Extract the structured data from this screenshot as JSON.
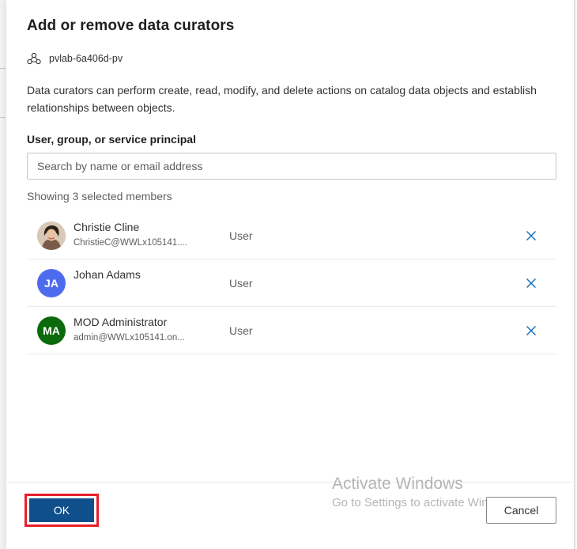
{
  "dialog": {
    "title": "Add or remove data curators",
    "collection_name": "pvlab-6a406d-pv",
    "description": "Data curators can perform create, read, modify, and delete actions on catalog data objects and establish relationships between objects."
  },
  "search": {
    "label": "User, group, or service principal",
    "placeholder": "Search by name or email address",
    "value": ""
  },
  "members": {
    "summary": "Showing 3 selected members",
    "items": [
      {
        "name": "Christie Cline",
        "email": "ChristieC@WWLx105141....",
        "type": "User",
        "initials": "",
        "avatar_color": "#8a6a58",
        "photo": true
      },
      {
        "name": "Johan Adams",
        "email": "",
        "type": "User",
        "initials": "JA",
        "avatar_color": "#4f6bed",
        "photo": false
      },
      {
        "name": "MOD Administrator",
        "email": "admin@WWLx105141.on...",
        "type": "User",
        "initials": "MA",
        "avatar_color": "#0b6a0b",
        "photo": false
      }
    ]
  },
  "footer": {
    "ok_label": "OK",
    "cancel_label": "Cancel"
  },
  "watermark": {
    "title": "Activate Windows",
    "subtitle": "Go to Settings to activate Windows."
  },
  "colors": {
    "primary": "#0f4f8b",
    "highlight": "#e8202a",
    "remove_icon": "#0f6cbd"
  }
}
